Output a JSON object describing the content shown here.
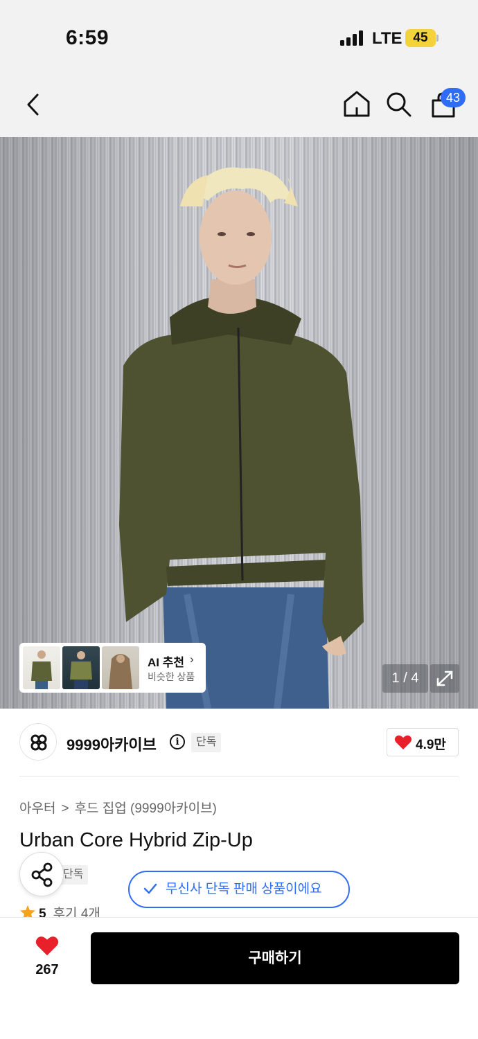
{
  "status_bar": {
    "time": "6:59",
    "network": "LTE",
    "battery": "45"
  },
  "nav": {
    "cart_count": "43"
  },
  "gallery": {
    "counter": "1 / 4",
    "ai_recommend": {
      "title": "AI 추천",
      "subtitle": "비슷한 상품"
    }
  },
  "brand": {
    "name": "9999아카이브",
    "exclusive_tag": "단독",
    "likes": "4.9만"
  },
  "product": {
    "breadcrumb": [
      "아우터",
      "후드 집업 (9999아카이브)"
    ],
    "title": "Urban Core Hybrid Zip-Up",
    "tag": "단독",
    "exclusive_notice": "무신사 단독 판매 상품이에요",
    "rating": "5",
    "reviews": "후기 4개"
  },
  "bottom": {
    "wish_count": "267",
    "buy_label": "구매하기"
  },
  "colors": {
    "accent_blue": "#2f6df6",
    "heart_red": "#e8202a",
    "rating_orange": "#f7a21b"
  }
}
